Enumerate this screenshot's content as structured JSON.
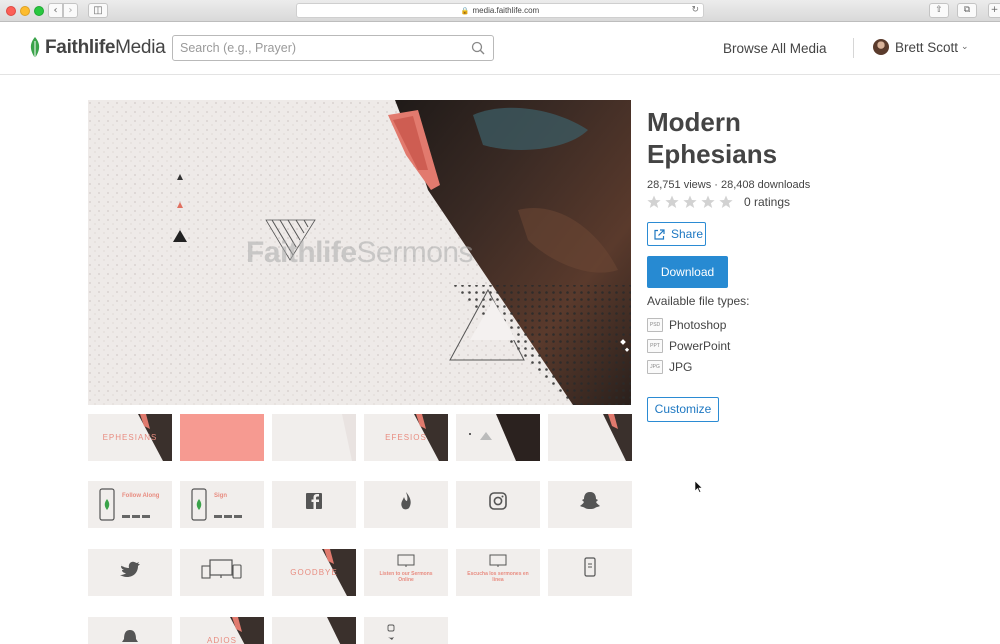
{
  "browser": {
    "url": "media.faithlife.com"
  },
  "header": {
    "logo_bold": "Faithlife",
    "logo_light": "Media",
    "search_placeholder": "Search (e.g., Prayer)",
    "browse_label": "Browse All Media",
    "user_name": "Brett Scott"
  },
  "preview": {
    "watermark_bold": "Faithlife",
    "watermark_light": "Sermons"
  },
  "thumbnails": [
    {
      "text": "EPHESIANS"
    },
    {
      "text": ""
    },
    {
      "text": ""
    },
    {
      "text": "EFESIOS"
    },
    {
      "text": ""
    },
    {
      "text": ""
    },
    {
      "text": "Follow Along"
    },
    {
      "text": "Sign"
    },
    {
      "text": ""
    },
    {
      "text": ""
    },
    {
      "text": ""
    },
    {
      "text": ""
    },
    {
      "text": ""
    },
    {
      "text": ""
    },
    {
      "text": "GOODBYE"
    },
    {
      "text": "Listen to our Sermons Online"
    },
    {
      "text": "Escucha los sermones en línea"
    },
    {
      "text": ""
    },
    {
      "text": ""
    },
    {
      "text": "ADIOS"
    },
    {
      "text": ""
    },
    {
      "text": ""
    }
  ],
  "details": {
    "title": "Modern Ephesians",
    "stats": "28,751 views · 28,408 downloads",
    "rating_stars": 0,
    "ratings_label": "0 ratings",
    "share_label": "Share",
    "download_label": "Download",
    "available_label": "Available file types:",
    "file_types": [
      {
        "ext": "PSD",
        "label": "Photoshop"
      },
      {
        "ext": "PPT",
        "label": "PowerPoint"
      },
      {
        "ext": "JPG",
        "label": "JPG"
      }
    ],
    "customize_label": "Customize"
  },
  "colors": {
    "accent": "#278ad2",
    "brand_green": "#3aa34a",
    "coral": "#f2918a"
  }
}
